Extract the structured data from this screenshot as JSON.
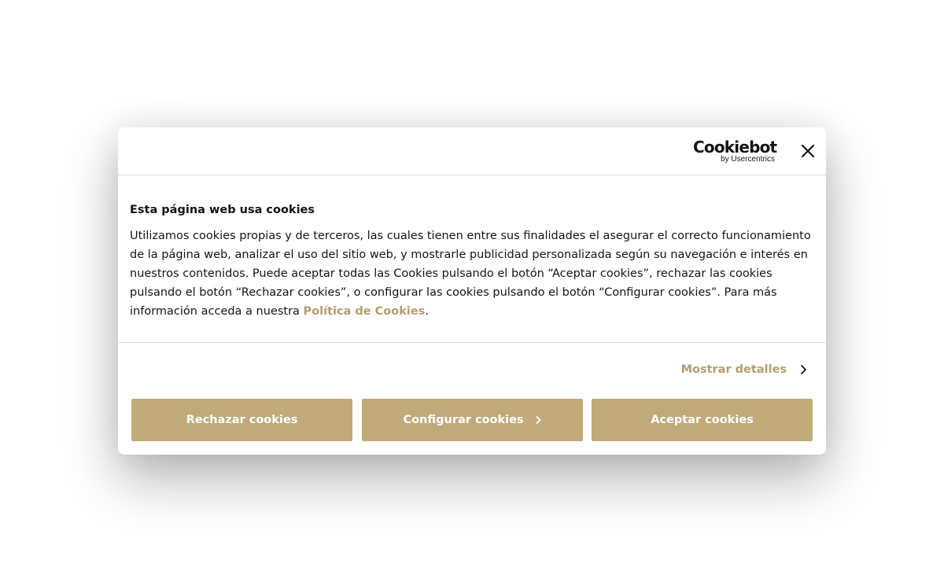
{
  "header": {
    "logo_word": "Cookiebot",
    "logo_sub": "by Usercentrics",
    "close_icon": "close-icon"
  },
  "body": {
    "title": "Esta página web usa cookies",
    "text_before_link": "Utilizamos cookies propias y de terceros, las cuales tienen entre sus finalidades el asegurar el correcto funcionamiento de la página web, analizar el uso del sitio web, y mostrarle publicidad personalizada según su navegación e interés en nuestros contenidos. Puede aceptar todas las Cookies pulsando el botón “Aceptar cookies”, rechazar las cookies pulsando el botón “Rechazar cookies”, o configurar las cookies pulsando el botón “Configurar cookies”. Para más información acceda a nuestra",
    "link_label": "Política de Cookies",
    "text_after_link": "."
  },
  "details": {
    "label": "Mostrar detalles",
    "icon": "chevron-right-icon"
  },
  "buttons": {
    "reject_label": "Rechazar cookies",
    "configure_label": "Configurar cookies",
    "accept_label": "Aceptar cookies"
  },
  "colors": {
    "accent": "#c0aa7a",
    "link": "#b59d6c",
    "text": "#141414",
    "divider": "#dcdcdc"
  }
}
